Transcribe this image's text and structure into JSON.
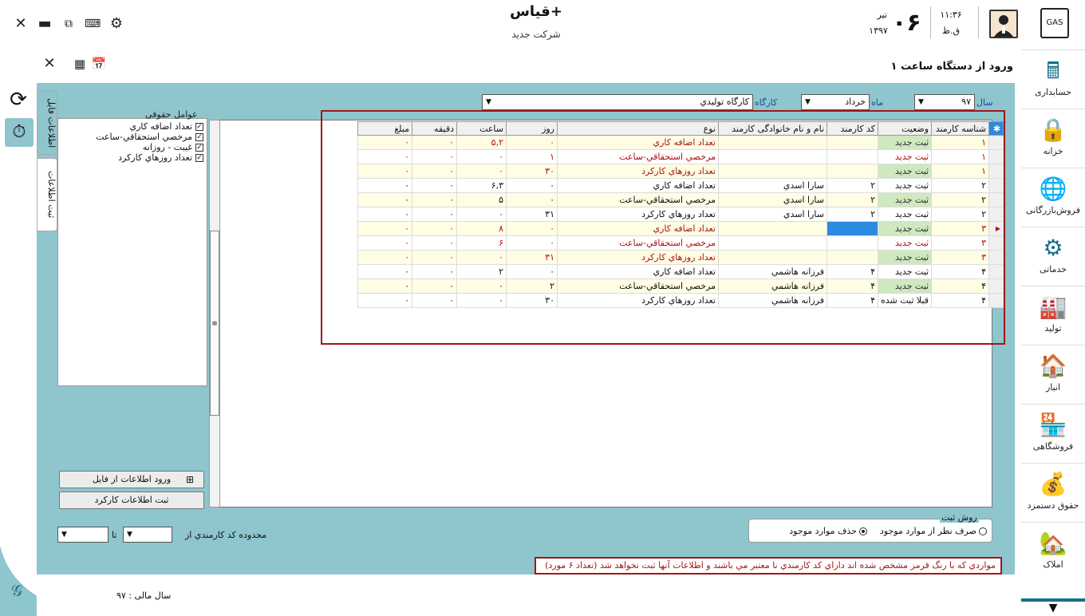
{
  "window": {
    "app_title": "قیاس+",
    "company": "شرکت جدید",
    "date_day": "۰۶",
    "date_month": "تیر",
    "date_year": "۱۳۹۷",
    "time": "۱۱:۳۶",
    "ampm": "ق.ظ",
    "icons": [
      "close-icon",
      "minimize-icon",
      "restore-icon",
      "keyboard-icon",
      "gear-icon"
    ]
  },
  "nav": {
    "logo_text": "GAS",
    "items": [
      {
        "label": "حسابداری",
        "icon": "🖩"
      },
      {
        "label": "خزانه",
        "icon": "🔒"
      },
      {
        "label": "فروش‌بازرگانی",
        "icon": "🌐"
      },
      {
        "label": "خدماتی",
        "icon": "⚙"
      },
      {
        "label": "تولید",
        "icon": "🏭"
      },
      {
        "label": "انبار",
        "icon": "🏠"
      },
      {
        "label": "فروشگاهی",
        "icon": "🏪"
      },
      {
        "label": "حقوق دستمزد",
        "icon": "💰"
      },
      {
        "label": "املاک",
        "icon": "🏡"
      }
    ],
    "down_arrow": "▼"
  },
  "page": {
    "title": "ورود از دستگاه ساعت ١",
    "tabs": [
      "اطلاعات فایل",
      "ثبت اطلاعات"
    ]
  },
  "filters": {
    "year_label": "سال",
    "year_value": "۹۷",
    "month_label": "ماه",
    "month_value": "خرداد",
    "workshop_label": "کارگاه",
    "workshop_value": "کارگاه تولیدي"
  },
  "left_panel": {
    "title": "عوامل حقوقی",
    "items": [
      "تعداد اضافه كاري",
      "مرخصي استحقاقي-ساعت",
      "غيبت - روزانه",
      "تعداد روزهاي كاركرد"
    ]
  },
  "grid": {
    "headers": [
      "شناسه کارمند",
      "وضعیت",
      "کد کارمند",
      "نام و نام خانوادگی کارمند",
      "نوع",
      "روز",
      "ساعت",
      "دقیقه",
      "مبلغ"
    ],
    "rows": [
      {
        "id": "۱",
        "status": "ثبت جدید",
        "code": "",
        "name": "",
        "type": "تعداد اضافه كاري",
        "day": "۰",
        "hour": "۵,۲",
        "min": "۰",
        "amount": "۰",
        "red": true,
        "green": true,
        "blue": false
      },
      {
        "id": "۱",
        "status": "ثبت جدید",
        "code": "",
        "name": "",
        "type": "مرخصي استحقاقي-ساعت",
        "day": "۱",
        "hour": "۰",
        "min": "۰",
        "amount": "۰",
        "red": true,
        "green": false,
        "blue": false
      },
      {
        "id": "۱",
        "status": "ثبت جدید",
        "code": "",
        "name": "",
        "type": "تعداد روزهاي كاركرد",
        "day": "۳۰",
        "hour": "۰",
        "min": "۰",
        "amount": "۰",
        "red": true,
        "green": true,
        "blue": false
      },
      {
        "id": "۲",
        "status": "ثبت جدید",
        "code": "۲",
        "name": "سارا اسدي",
        "type": "تعداد اضافه كاري",
        "day": "۰",
        "hour": "۶,۳",
        "min": "۰",
        "amount": "۰",
        "red": false,
        "green": false,
        "blue": false
      },
      {
        "id": "۲",
        "status": "ثبت جدید",
        "code": "۲",
        "name": "سارا اسدي",
        "type": "مرخصي استحقاقي-ساعت",
        "day": "۰",
        "hour": "۵",
        "min": "۰",
        "amount": "۰",
        "red": false,
        "green": true,
        "blue": false
      },
      {
        "id": "۲",
        "status": "ثبت جدید",
        "code": "۲",
        "name": "سارا اسدي",
        "type": "تعداد روزهاي كاركرد",
        "day": "۳۱",
        "hour": "۰",
        "min": "۰",
        "amount": "۰",
        "red": false,
        "green": false,
        "blue": false
      },
      {
        "id": "۳",
        "status": "ثبت جدید",
        "code": "",
        "name": "",
        "type": "تعداد اضافه كاري",
        "day": "۰",
        "hour": "۸",
        "min": "۰",
        "amount": "۰",
        "red": true,
        "green": true,
        "blue": true
      },
      {
        "id": "۳",
        "status": "ثبت جدید",
        "code": "",
        "name": "",
        "type": "مرخصي استحقاقي-ساعت",
        "day": "۰",
        "hour": "۶",
        "min": "۰",
        "amount": "۰",
        "red": true,
        "green": false,
        "blue": false
      },
      {
        "id": "۳",
        "status": "ثبت جدید",
        "code": "",
        "name": "",
        "type": "تعداد روزهاي كاركرد",
        "day": "۳۱",
        "hour": "۰",
        "min": "۰",
        "amount": "۰",
        "red": true,
        "green": true,
        "blue": false
      },
      {
        "id": "۴",
        "status": "ثبت جدید",
        "code": "۴",
        "name": "فرزانه هاشمي",
        "type": "تعداد اضافه كاري",
        "day": "۰",
        "hour": "۲",
        "min": "۰",
        "amount": "۰",
        "red": false,
        "green": false,
        "blue": false
      },
      {
        "id": "۴",
        "status": "ثبت جدید",
        "code": "۴",
        "name": "فرزانه هاشمي",
        "type": "مرخصي استحقاقي-ساعت",
        "day": "۲",
        "hour": "۰",
        "min": "۰",
        "amount": "۰",
        "red": false,
        "green": true,
        "blue": false
      },
      {
        "id": "۴",
        "status": "قبلا ثبت شده",
        "code": "۴",
        "name": "فرزانه هاشمي",
        "type": "تعداد روزهاي كاركرد",
        "day": "۳۰",
        "hour": "۰",
        "min": "۰",
        "amount": "۰",
        "red": false,
        "green": false,
        "blue": false
      }
    ]
  },
  "buttons": {
    "import_file": "ورود اطلاعات از فايل",
    "save_work": "ثبت اطلاعات كاركرد"
  },
  "range": {
    "label": "محدوده کد کارمندي از",
    "to_label": "تا"
  },
  "save_method": {
    "title": "روش ثبت",
    "option_ignore": "صرف نظر از موارد موجود",
    "option_delete": "حذف موارد موجود",
    "selected": "delete"
  },
  "warning": "مواردي كه با رنگ قرمز مشخص شده اند داراي کد کارمندي نا معتبر مي باشند و اطلاعات آنها ثبت نخواهد شد (تعداد ۶ مورد)",
  "fiscal_year": "سال مالی : ۹۷",
  "colors": {
    "teal": "#8fc5cc",
    "accent": "#13708a",
    "error": "#a01818",
    "row_yellow": "#fffde4",
    "row_green": "#cfe8c0"
  }
}
